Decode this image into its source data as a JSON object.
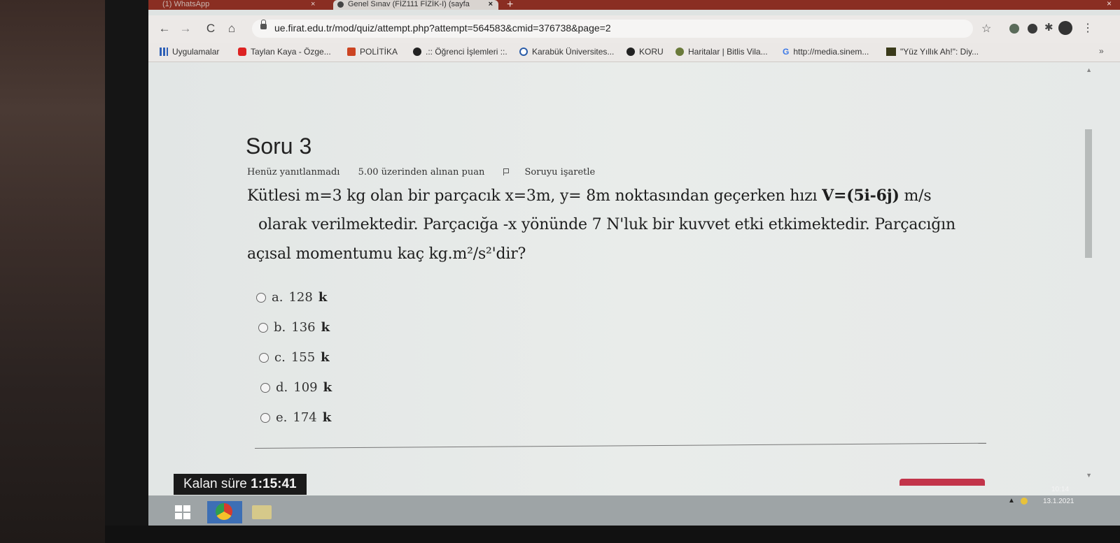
{
  "browser": {
    "tabs": [
      {
        "label": "(1) WhatsApp"
      },
      {
        "label": "Genel Sınav (FİZ111 FİZİK-I) (sayfa"
      }
    ],
    "url": "ue.firat.edu.tr/mod/quiz/attempt.php?attempt=564583&cmid=376738&page=2",
    "bookmarks": [
      {
        "label": "Uygulamalar"
      },
      {
        "label": "Taylan Kaya - Özge..."
      },
      {
        "label": "POLİTİKA"
      },
      {
        "label": ".:: Öğrenci İşlemleri ::."
      },
      {
        "label": "Karabük Üniversites..."
      },
      {
        "label": "KORU"
      },
      {
        "label": "Haritalar | Bitlis Vila..."
      },
      {
        "label": "http://media.sinem..."
      },
      {
        "label": "\"Yüz Yıllık Ah!\": Diy..."
      }
    ],
    "bookmarks_more": "»"
  },
  "question": {
    "title": "Soru 3",
    "status": "Henüz yanıtlanmadı",
    "points": "5.00 üzerinden alınan puan",
    "flag_label": "Soruyu işaretle",
    "line1_a": "Kütlesi m=3 kg olan bir parçacık x=3m, y= 8m noktasından geçerken hızı ",
    "line1_bold": "V=(5i-6j)",
    "line1_b": " m/s",
    "line2": "olarak verilmektedir. Parçacığa -x yönünde 7 N'luk bir kuvvet etki etkimektedir. Parçacığın",
    "line3": "açısal momentumu kaç kg.m²/s²'dir?",
    "options": [
      {
        "letter": "a.",
        "value": "128",
        "unit": "k"
      },
      {
        "letter": "b.",
        "value": "136",
        "unit": "k"
      },
      {
        "letter": "c.",
        "value": "155",
        "unit": "k"
      },
      {
        "letter": "d.",
        "value": "109",
        "unit": "k"
      },
      {
        "letter": "e.",
        "value": "174",
        "unit": "k"
      }
    ]
  },
  "timer": {
    "label": "Kalan süre ",
    "value": "1:15:41"
  },
  "taskbar": {
    "time": "10:14",
    "date": "13.1.2021"
  },
  "icons": {
    "tab_close": "×",
    "new_tab": "+",
    "window_close": "×",
    "back": "←",
    "forward": "→",
    "reload": "C",
    "home": "⌂",
    "star": "☆",
    "puzzle": "✱",
    "menu": "⋮",
    "chevron_up": "▲",
    "chevron_down": "▼"
  }
}
